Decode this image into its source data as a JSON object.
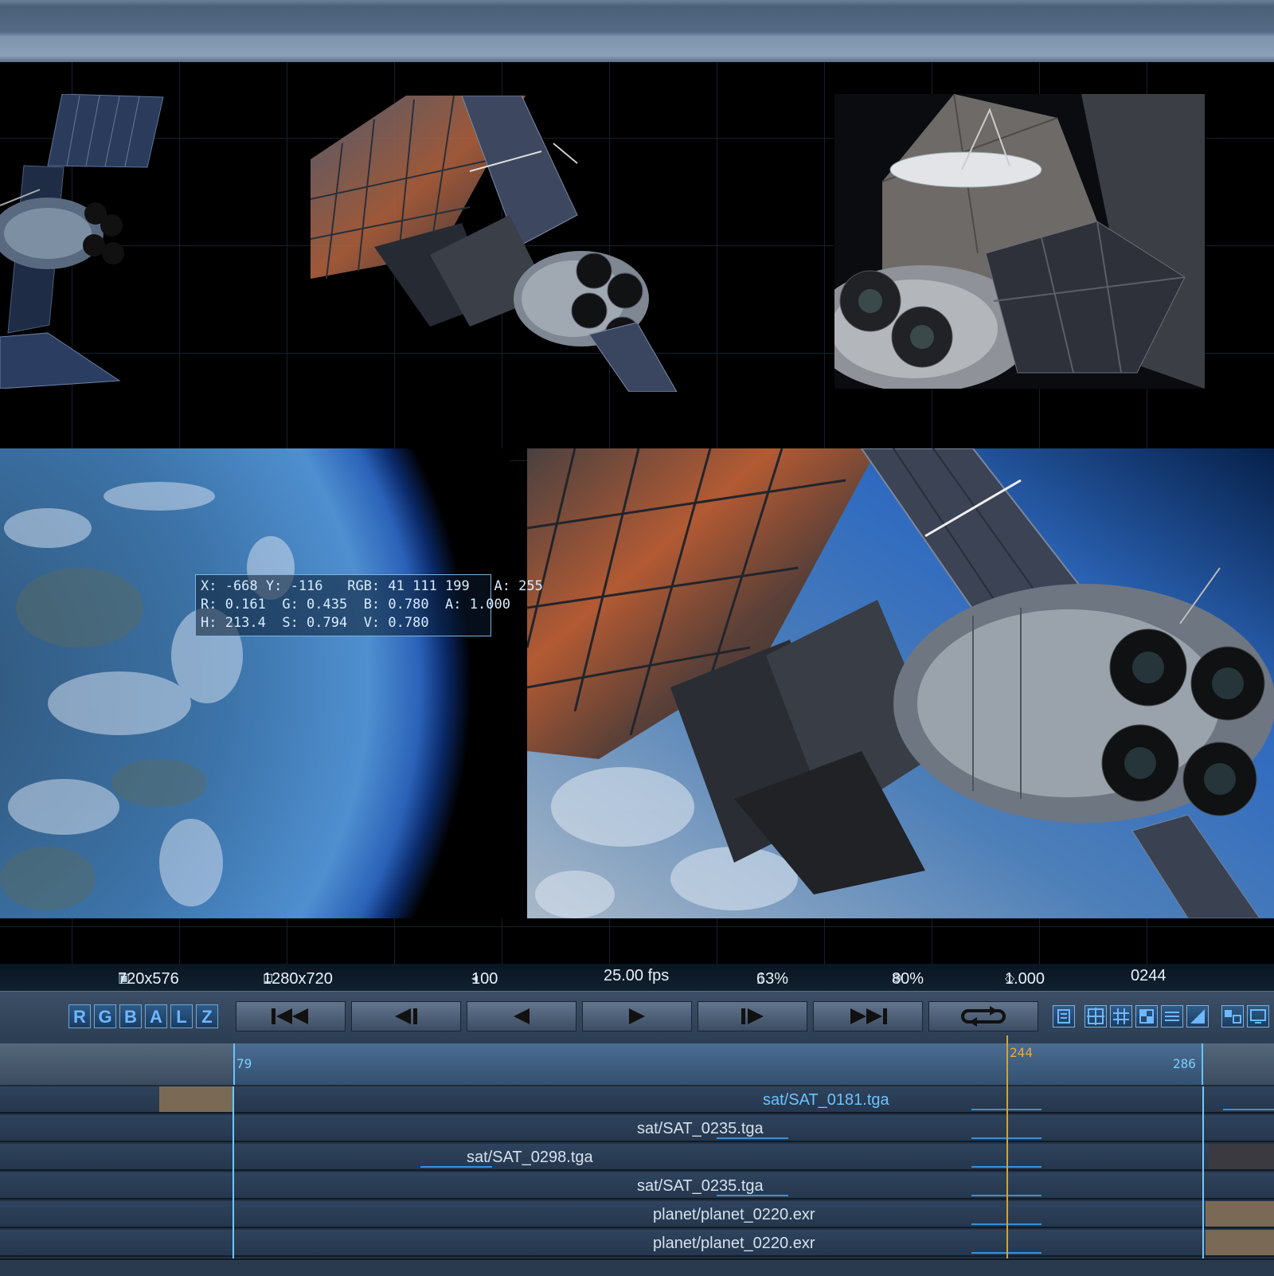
{
  "readout": {
    "line1": "X: -668 Y: -116   RGB: 41 111 199   A: 255",
    "line2": "R: 0.161  G: 0.435  B: 0.780  A: 1.000",
    "line3": "H: 213.4  S: 0.794  V: 0.780"
  },
  "status": {
    "source_res": "720x576",
    "target_res": "1280x720",
    "volume": "100",
    "fps": "25.00 fps",
    "cache": "63%",
    "zoom": "80%",
    "ratio": "1.000",
    "frame": "0244"
  },
  "channels": [
    "R",
    "G",
    "B",
    "A",
    "L",
    "Z"
  ],
  "transport": [
    {
      "name": "go-to-start-button",
      "icon": "skip-start-icon"
    },
    {
      "name": "step-back-button",
      "icon": "step-back-icon"
    },
    {
      "name": "play-reverse-button",
      "icon": "play-reverse-icon"
    },
    {
      "name": "play-button",
      "icon": "play-icon"
    },
    {
      "name": "step-forward-button",
      "icon": "step-forward-icon"
    },
    {
      "name": "go-to-end-button",
      "icon": "skip-end-icon"
    },
    {
      "name": "loop-button",
      "icon": "loop-icon"
    }
  ],
  "ruler": {
    "in": "79",
    "current": "244",
    "out": "286"
  },
  "tracks": [
    {
      "label": "sat/SAT_0181.tga",
      "selected": true
    },
    {
      "label": "sat/SAT_0235.tga",
      "selected": false
    },
    {
      "label": "sat/SAT_0298.tga",
      "selected": false
    },
    {
      "label": "sat/SAT_0235.tga",
      "selected": false
    },
    {
      "label": "planet/planet_0220.exr",
      "selected": false
    },
    {
      "label": "planet/planet_0220.exr",
      "selected": false
    }
  ],
  "colors": {
    "accent": "#6fc8ff",
    "playhead": "#e0a020",
    "clip": "#7a6a55"
  }
}
